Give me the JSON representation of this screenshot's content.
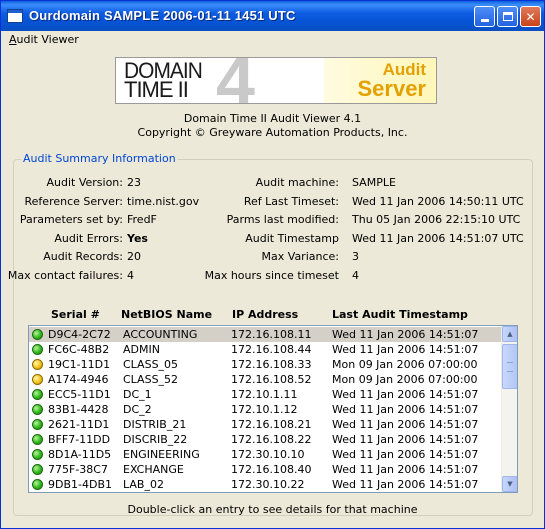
{
  "window": {
    "title": "Ourdomain SAMPLE 2006-01-11 1451 UTC"
  },
  "menu": {
    "audit_viewer_first": "A",
    "audit_viewer_rest": "udit Viewer"
  },
  "banner": {
    "logo_line1": "DOMAIN",
    "logo_line2": "TIME II",
    "logo_number": "4",
    "logo_audit": "Audit",
    "logo_server": "Server"
  },
  "about": {
    "product": "Domain Time II Audit Viewer 4.1",
    "copyright": "Copyright © Greyware Automation Products, Inc."
  },
  "summary": {
    "group_label": "Audit Summary Information",
    "left": [
      {
        "label": "Audit Version:",
        "value": "23",
        "bold": false
      },
      {
        "label": "Reference Server:",
        "value": "time.nist.gov",
        "bold": false
      },
      {
        "label": "Parameters set by:",
        "value": "FredF",
        "bold": false
      },
      {
        "label": "Audit Errors:",
        "value": "Yes",
        "bold": true
      },
      {
        "label": "Audit Records:",
        "value": "20",
        "bold": false
      },
      {
        "label": "Max contact failures:",
        "value": "4",
        "bold": false
      }
    ],
    "right": [
      {
        "label": "Audit machine:",
        "value": "SAMPLE"
      },
      {
        "label": "Ref Last Timeset:",
        "value": "Wed 11 Jan 2006 14:50:11 UTC"
      },
      {
        "label": "Parms last modified:",
        "value": "Thu 05 Jan 2006 22:15:10 UTC"
      },
      {
        "label": "Audit Timestamp",
        "value": "Wed 11 Jan 2006 14:51:07 UTC"
      },
      {
        "label": "Max Variance:",
        "value": "3"
      },
      {
        "label": "Max hours since timeset",
        "value": "4"
      }
    ]
  },
  "table": {
    "columns": [
      "Serial #",
      "NetBIOS Name",
      "IP Address",
      "Last Audit Timestamp"
    ],
    "rows": [
      {
        "status": "green",
        "serial": "D9C4-2C72",
        "name": "ACCOUNTING",
        "ip": "172.16.108.11",
        "timestamp": "Wed 11 Jan 2006 14:51:07",
        "selected": true
      },
      {
        "status": "green",
        "serial": "FC6C-48B2",
        "name": "ADMIN",
        "ip": "172.16.108.44",
        "timestamp": "Wed 11 Jan 2006 14:51:07",
        "selected": false
      },
      {
        "status": "yellow",
        "serial": "19C1-11D1",
        "name": "CLASS_05",
        "ip": "172.16.108.33",
        "timestamp": "Mon 09 Jan 2006 07:00:00",
        "selected": false
      },
      {
        "status": "yellow",
        "serial": "A174-4946",
        "name": "CLASS_52",
        "ip": "172.16.108.52",
        "timestamp": "Mon 09 Jan 2006 07:00:00",
        "selected": false
      },
      {
        "status": "green",
        "serial": "ECC5-11D1",
        "name": "DC_1",
        "ip": "172.10.1.11",
        "timestamp": "Wed 11 Jan 2006 14:51:07",
        "selected": false
      },
      {
        "status": "green",
        "serial": "83B1-4428",
        "name": "DC_2",
        "ip": "172.10.1.12",
        "timestamp": "Wed 11 Jan 2006 14:51:07",
        "selected": false
      },
      {
        "status": "green",
        "serial": "2621-11D1",
        "name": "DISTRIB_21",
        "ip": "172.16.108.21",
        "timestamp": "Wed 11 Jan 2006 14:51:07",
        "selected": false
      },
      {
        "status": "green",
        "serial": "BFF7-11DD",
        "name": "DISCRIB_22",
        "ip": "172.16.108.22",
        "timestamp": "Wed 11 Jan 2006 14:51:07",
        "selected": false
      },
      {
        "status": "green",
        "serial": "8D1A-11D5",
        "name": "ENGINEERING",
        "ip": "172.30.10.10",
        "timestamp": "Wed 11 Jan 2006 14:51:07",
        "selected": false
      },
      {
        "status": "green",
        "serial": "775F-38C7",
        "name": "EXCHANGE",
        "ip": "172.16.108.40",
        "timestamp": "Wed 11 Jan 2006 14:51:07",
        "selected": false
      },
      {
        "status": "green",
        "serial": "9DB1-4DB1",
        "name": "LAB_02",
        "ip": "172.30.10.22",
        "timestamp": "Wed 11 Jan 2006 14:51:07",
        "selected": false
      }
    ]
  },
  "footer": {
    "hint": "Double-click an entry to see details for that machine"
  }
}
